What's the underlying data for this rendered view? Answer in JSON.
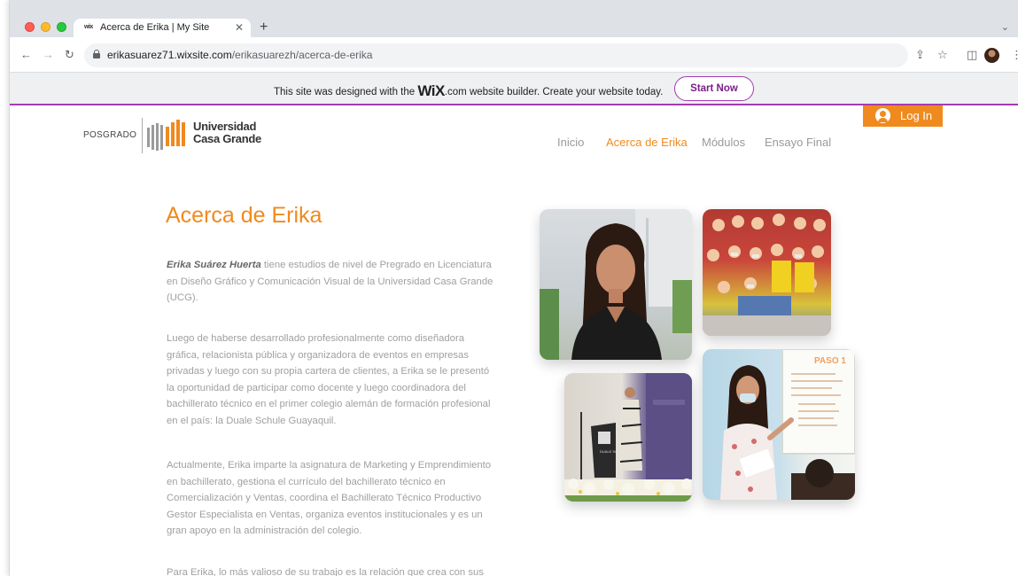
{
  "browser": {
    "tab_title": "Acerca de Erika | My Site",
    "tab_favicon": "wix",
    "url_host": "erikasuarez71.wixsite.com",
    "url_path": "/erikasuarezh/acerca-de-erika"
  },
  "wix_banner": {
    "text_before": "This site was designed with the ",
    "logo": "WiX",
    "text_after": ".com website builder. Create your website today.",
    "button_label": "Start Now"
  },
  "site_header": {
    "posgrado": "POSGRADO",
    "logo_line1": "Universidad",
    "logo_line2": "Casa Grande",
    "login_label": "Log In",
    "menu": [
      "Inicio",
      "Acerca de Erika",
      "Módulos",
      "Ensayo Final"
    ],
    "active_menu": "Acerca de Erika"
  },
  "content": {
    "title": "Acerca de Erika",
    "p1_name": "Erika Suárez Huerta",
    "p1_rest": " tiene estudios de nivel de Pregrado en Licenciatura en Diseño Gráfico y Comunicación Visual de la Universidad Casa Grande (UCG).",
    "p2": "Luego de haberse desarrollado profesionalmente como diseñadora gráfica, relacionista pública y organizadora de eventos en empresas privadas y luego con su propia cartera de clientes, a Erika se le presentó la oportunidad de participar como docente y luego coordinadora del bachillerato técnico en el primer colegio alemán de formación profesional en el país: la Duale Schule Guayaquil.",
    "p3": "Actualmente, Erika imparte la asignatura de Marketing y Emprendimiento en bachillerato, gestiona el currículo del bachillerato técnico en Comercialización y Ventas, coordina el Bachillerato Técnico Productivo Gestor Especialista en Ventas, organiza eventos institucionales y es un gran apoyo en la administración del colegio.",
    "p4": "Para Erika, lo más valioso de su trabajo es la relación que crea con sus"
  },
  "photos": {
    "classroom_board_text": "PASO 1",
    "podium_sign_text": "DUALE SCHULE"
  },
  "colors": {
    "accent_orange": "#f08a1e",
    "wix_purple": "#a43cb0",
    "body_text": "#a0a0a0"
  }
}
